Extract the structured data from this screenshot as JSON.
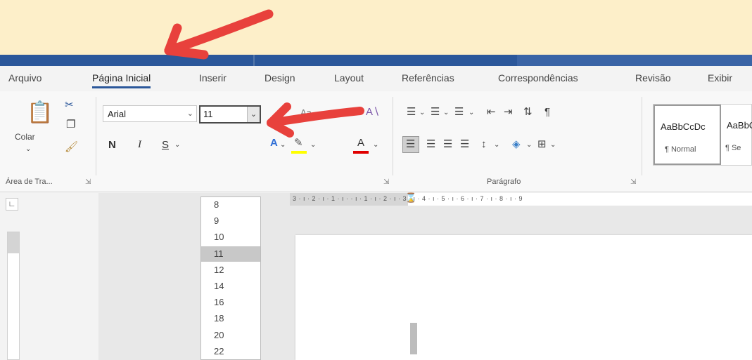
{
  "tabs": [
    "Arquivo",
    "Página Inicial",
    "Inserir",
    "Design",
    "Layout",
    "Referências",
    "Correspondências",
    "Revisão",
    "Exibir"
  ],
  "active_tab": "Página Inicial",
  "clipboard": {
    "paste_label": "Colar",
    "group_label": "Área de Tra..."
  },
  "font": {
    "name": "Arial",
    "size": "11"
  },
  "format_buttons": {
    "bold": "N",
    "italic": "I",
    "underline": "S"
  },
  "paragraph": {
    "group_label": "Parágrafo"
  },
  "styles": [
    {
      "preview": "AaBbCcDc",
      "name": "¶ Normal"
    },
    {
      "preview": "AaBbCcDc",
      "name": "¶ Se"
    }
  ],
  "ruler": {
    "text": "3 · ı · 2 · ı · 1 · ı ·    · ı · 1 · ı · 2 · ı · 3 · ı · 4 · ı · 5 · ı · 6 · ı · 7 · ı · 8 · ı · 9"
  },
  "font_size_options": [
    "8",
    "9",
    "10",
    "11",
    "12",
    "14",
    "16",
    "18",
    "20",
    "22"
  ],
  "selected_size": "11",
  "colors": {
    "title_bar": "#2b579a",
    "banner": "#fdefc9",
    "arrow": "#e8413c",
    "selection": "#c8c8c8"
  }
}
